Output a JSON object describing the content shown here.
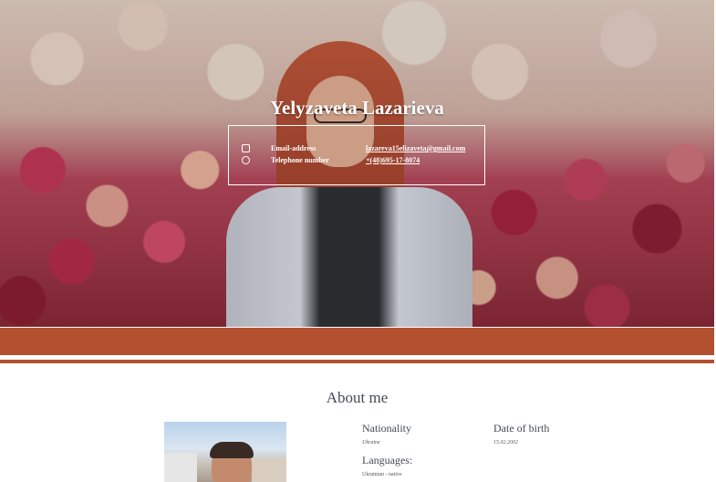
{
  "header": {
    "name": "Yelyzaveta Lazarieva",
    "contacts": [
      {
        "icon": "envelope-icon",
        "label": "Email-address",
        "value": "lazareva15elizaveta@gmail.com"
      },
      {
        "icon": "phone-icon",
        "label": "Telephone number",
        "value": "+(48)695-17-8074"
      }
    ]
  },
  "about": {
    "title": "About me",
    "nationality_label": "Nationality",
    "nationality_value": "Ukraine",
    "dob_label": "Date of birth",
    "dob_value": "15.02.2002",
    "languages_label": "Languages:",
    "languages_value": "Ukrainian - native"
  },
  "colors": {
    "accent": "#b2502f",
    "text": "#444a52"
  }
}
